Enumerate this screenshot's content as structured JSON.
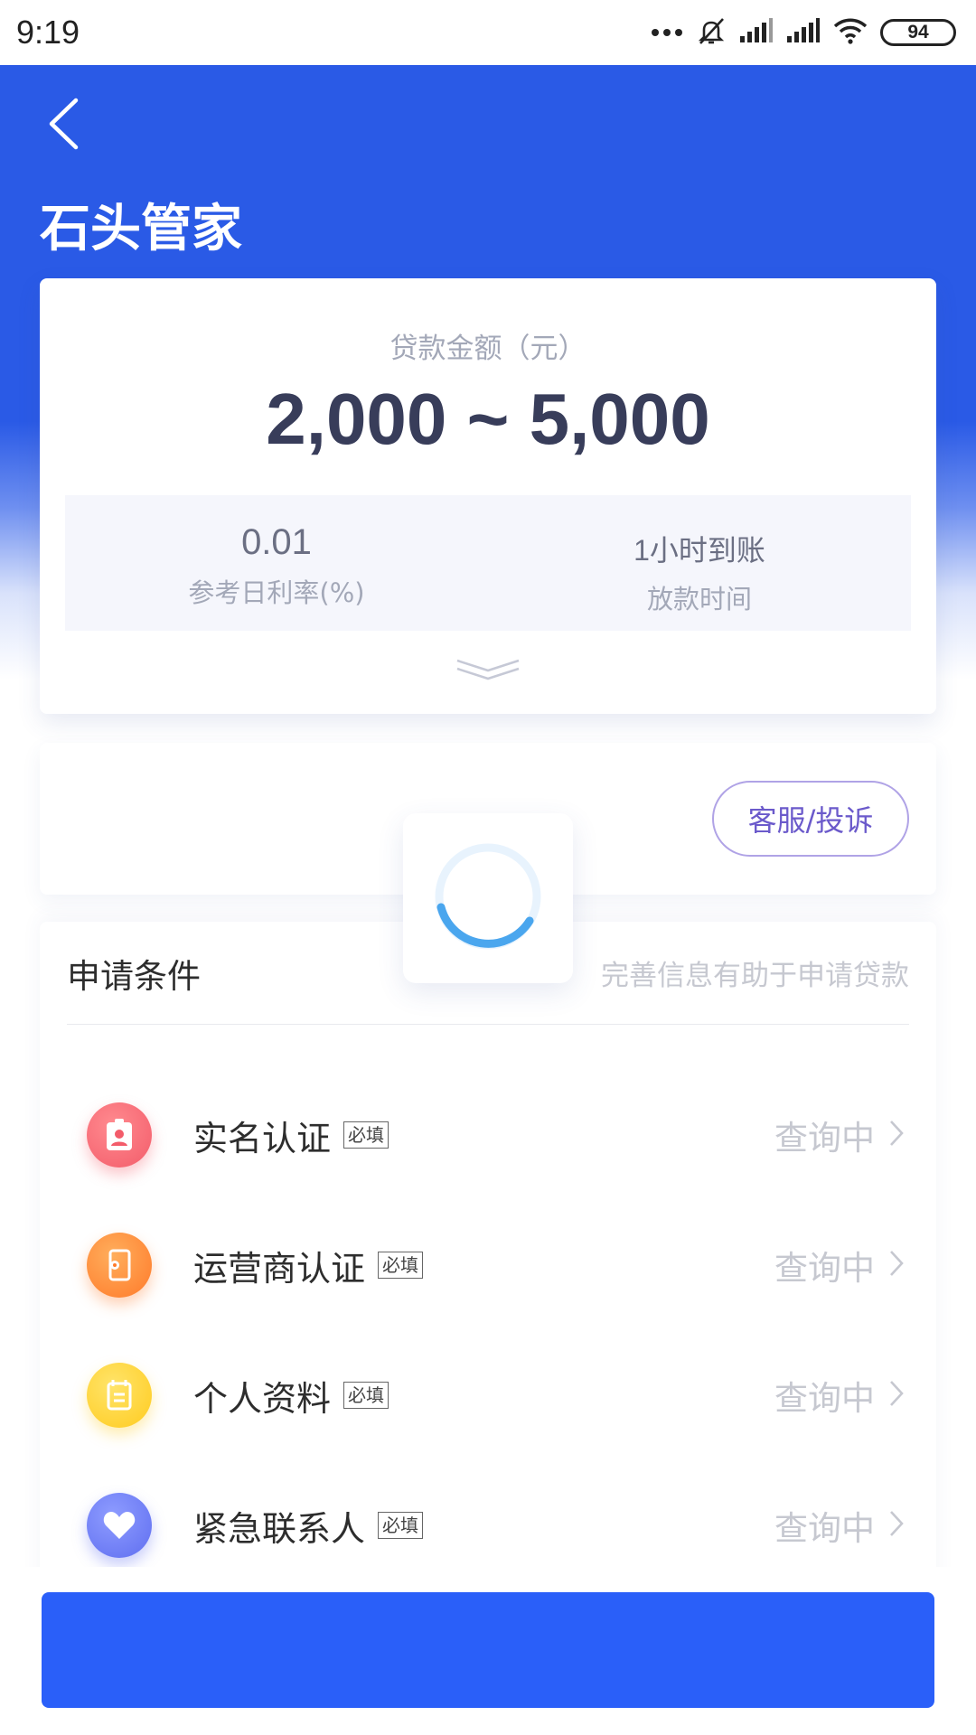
{
  "status_bar": {
    "time": "9:19",
    "battery": "94",
    "icons": [
      "more-dots-icon",
      "alarm-off-icon",
      "signal-icon",
      "signal-icon",
      "wifi-icon",
      "battery-icon"
    ]
  },
  "header": {
    "title": "石头管家",
    "back_icon": "chevron-left-icon",
    "color": "#2a5ae6"
  },
  "loan_card": {
    "label": "贷款金额（元）",
    "amount": "2,000 ~ 5,000",
    "stats": [
      {
        "value": "0.01",
        "label": "参考日利率(%)"
      },
      {
        "value": "1小时到账",
        "label": "放款时间"
      }
    ],
    "expand_icon": "double-chevron-down-icon"
  },
  "service": {
    "button_label": "客服/投诉"
  },
  "conditions": {
    "title": "申请条件",
    "hint": "完善信息有助于申请贷款",
    "required_tag": "必填",
    "items": [
      {
        "label": "实名认证",
        "status": "查询中",
        "icon": "id-card-icon",
        "color": "#f35c6a"
      },
      {
        "label": "运营商认证",
        "status": "查询中",
        "icon": "phone-settings-icon",
        "color": "#ff8a34"
      },
      {
        "label": "个人资料",
        "status": "查询中",
        "icon": "document-icon",
        "color": "#ffd22e"
      },
      {
        "label": "紧急联系人",
        "status": "查询中",
        "icon": "heart-icon",
        "color": "#6a7cf6"
      }
    ]
  },
  "loading": {
    "icon": "loading-spinner-icon"
  },
  "bottom": {
    "apply_label": "",
    "color": "#2a5ff9"
  }
}
